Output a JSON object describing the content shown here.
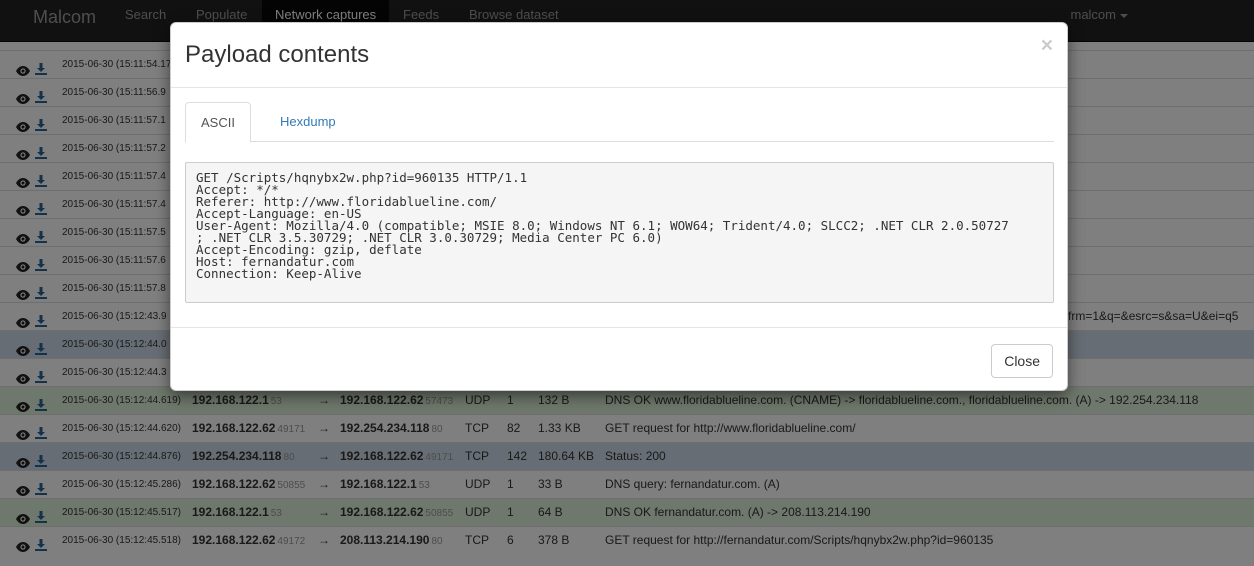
{
  "navbar": {
    "brand": "Malcom",
    "items": [
      {
        "label": "Search"
      },
      {
        "label": "Populate"
      },
      {
        "label": "Network captures"
      },
      {
        "label": "Feeds"
      },
      {
        "label": "Browse dataset"
      }
    ],
    "user": "malcom"
  },
  "table": {
    "rows": [
      {
        "time": "2015-06-30 (15:11:54.17",
        "style": ""
      },
      {
        "time": "2015-06-30 (15:11:56.9",
        "style": ""
      },
      {
        "time": "2015-06-30 (15:11:57.1",
        "style": ""
      },
      {
        "time": "2015-06-30 (15:11:57.2",
        "style": ""
      },
      {
        "time": "2015-06-30 (15:11:57.4",
        "style": ""
      },
      {
        "time": "2015-06-30 (15:11:57.4",
        "style": ""
      },
      {
        "time": "2015-06-30 (15:11:57.5",
        "style": ""
      },
      {
        "time": "2015-06-30 (15:11:57.6",
        "style": ""
      },
      {
        "time": "2015-06-30 (15:11:57.8",
        "style": ""
      },
      {
        "time": "2015-06-30 (15:12:43.9",
        "style": "",
        "tail": "frm=1&q=&esrc=s&sa=U&ei=q5"
      },
      {
        "time": "2015-06-30 (15:12:44.0",
        "style": "info"
      },
      {
        "time": "2015-06-30 (15:12:44.3",
        "style": ""
      },
      {
        "time": "2015-06-30 (15:12:44.619)",
        "style": "green",
        "src": "192.168.122.1",
        "sport": "53",
        "dst": "192.168.122.62",
        "dport": "57473",
        "proto": "UDP",
        "count": "1",
        "size": "132 B",
        "desc": "DNS OK www.floridablueline.com. (CNAME) -> floridablueline.com., floridablueline.com. (A) -> 192.254.234.118"
      },
      {
        "time": "2015-06-30 (15:12:44.620)",
        "style": "",
        "src": "192.168.122.62",
        "sport": "49171",
        "dst": "192.254.234.118",
        "dport": "80",
        "proto": "TCP",
        "count": "82",
        "size": "1.33 KB",
        "desc": "GET request for http://www.floridablueline.com/"
      },
      {
        "time": "2015-06-30 (15:12:44.876)",
        "style": "info",
        "src": "192.254.234.118",
        "sport": "80",
        "dst": "192.168.122.62",
        "dport": "49171",
        "proto": "TCP",
        "count": "142",
        "size": "180.64 KB",
        "desc": "Status: 200"
      },
      {
        "time": "2015-06-30 (15:12:45.286)",
        "style": "",
        "src": "192.168.122.62",
        "sport": "50855",
        "dst": "192.168.122.1",
        "dport": "53",
        "proto": "UDP",
        "count": "1",
        "size": "33 B",
        "desc": "DNS query: fernandatur.com. (A)"
      },
      {
        "time": "2015-06-30 (15:12:45.517)",
        "style": "green",
        "src": "192.168.122.1",
        "sport": "53",
        "dst": "192.168.122.62",
        "dport": "50855",
        "proto": "UDP",
        "count": "1",
        "size": "64 B",
        "desc": "DNS OK fernandatur.com. (A) -> 208.113.214.190"
      },
      {
        "time": "2015-06-30 (15:12:45.518)",
        "style": "",
        "src": "192.168.122.62",
        "sport": "49172",
        "dst": "208.113.214.190",
        "dport": "80",
        "proto": "TCP",
        "count": "6",
        "size": "378 B",
        "desc": "GET request for http://fernandatur.com/Scripts/hqnybx2w.php?id=960135"
      }
    ],
    "arrow": "→"
  },
  "modal": {
    "title": "Payload contents",
    "close_glyph": "×",
    "tabs": [
      {
        "label": "ASCII"
      },
      {
        "label": "Hexdump"
      }
    ],
    "payload_lines": [
      "GET /Scripts/hqnybx2w.php?id=960135 HTTP/1.1",
      "Accept: */*",
      "Referer: http://www.floridablueline.com/",
      "Accept-Language: en-US",
      "User-Agent: Mozilla/4.0 (compatible; MSIE 8.0; Windows NT 6.1; WOW64; Trident/4.0; SLCC2; .NET CLR 2.0.50727",
      "; .NET CLR 3.5.30729; .NET CLR 3.0.30729; Media Center PC 6.0)",
      "Accept-Encoding: gzip, deflate",
      "Host: fernandatur.com",
      "Connection: Keep-Alive"
    ],
    "close_button": "Close"
  },
  "colors": {
    "navbar_bg": "#222222",
    "row_green": "#dff0d8",
    "row_info": "#cfdbe9",
    "icon": "#2a6496",
    "link": "#337ab7"
  },
  "icons": {
    "view": "eye-icon",
    "download": "download-icon",
    "caret": "caret-down-icon"
  }
}
